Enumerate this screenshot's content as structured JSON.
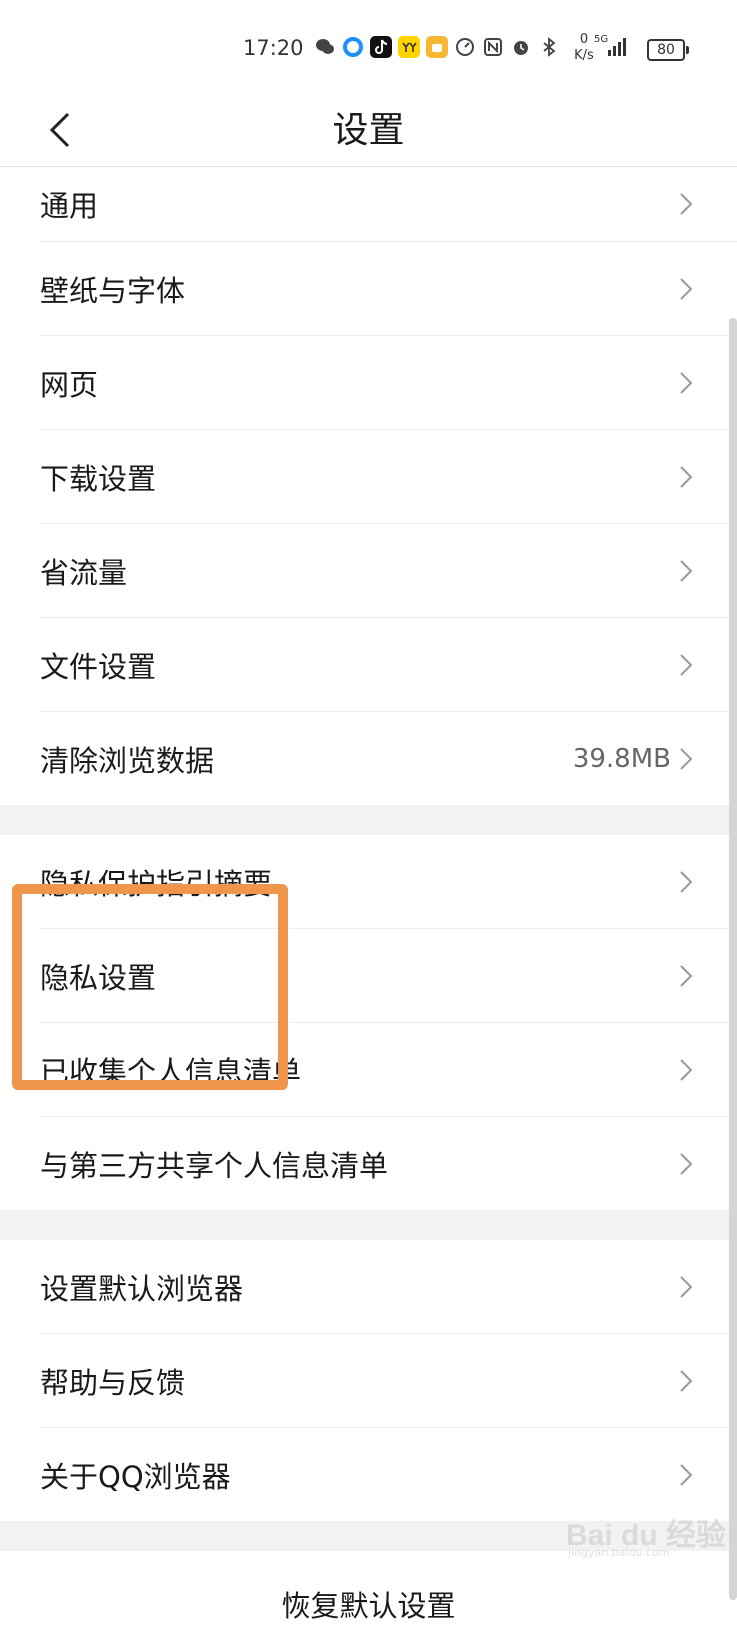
{
  "status_bar": {
    "time": "17:20",
    "net_speed_value": "0",
    "net_speed_unit": "K/s",
    "network_type": "5G",
    "battery": "80"
  },
  "header": {
    "back_icon": "chevron-left-icon",
    "title": "设置"
  },
  "groups": [
    {
      "items": [
        {
          "label": "通用"
        },
        {
          "label": "壁纸与字体"
        },
        {
          "label": "网页"
        },
        {
          "label": "下载设置"
        },
        {
          "label": "省流量"
        },
        {
          "label": "文件设置"
        },
        {
          "label": "清除浏览数据",
          "value": "39.8MB"
        }
      ]
    },
    {
      "items": [
        {
          "label": "隐私保护指引摘要"
        },
        {
          "label": "隐私设置"
        },
        {
          "label": "已收集个人信息清单"
        },
        {
          "label": "与第三方共享个人信息清单"
        }
      ]
    },
    {
      "items": [
        {
          "label": "设置默认浏览器"
        },
        {
          "label": "帮助与反馈"
        },
        {
          "label": "关于QQ浏览器"
        }
      ]
    }
  ],
  "bottom": {
    "label": "恢复默认设置"
  },
  "watermark": {
    "brand": "Bai du 经验",
    "url": "jingyan.baidu.com"
  },
  "colors": {
    "highlight": "#f0954c",
    "group_gap": "#f2f2f2",
    "text": "#1a1a1a",
    "chevron": "#999999"
  }
}
